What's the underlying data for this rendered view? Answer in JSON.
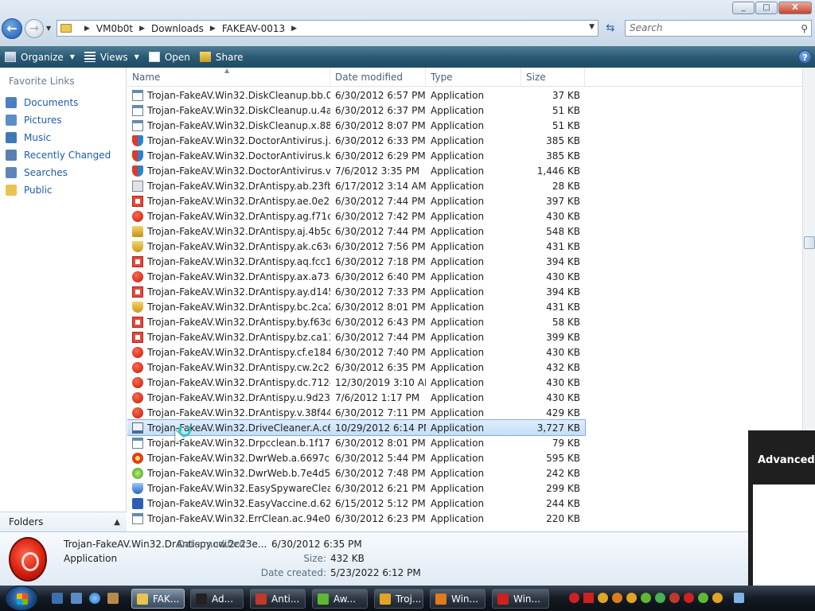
{
  "window": {
    "buttons": [
      "_",
      "□",
      "X"
    ]
  },
  "address": {
    "crumbs": [
      "VM0b0t",
      "Downloads",
      "FAKEAV-0013"
    ],
    "search_placeholder": "Search"
  },
  "toolbar": {
    "organize": "Organize",
    "views": "Views",
    "open": "Open",
    "share": "Share",
    "help": "?"
  },
  "navpane": {
    "header": "Favorite Links",
    "items": [
      {
        "label": "Documents",
        "icon": "documents-icon",
        "color": "#4a7fc0"
      },
      {
        "label": "Pictures",
        "icon": "pictures-icon",
        "color": "#5c8fc5"
      },
      {
        "label": "Music",
        "icon": "music-icon",
        "color": "#3f78b8"
      },
      {
        "label": "Recently Changed",
        "icon": "recently-changed-icon",
        "color": "#5a7fb3"
      },
      {
        "label": "Searches",
        "icon": "searches-icon",
        "color": "#5c86b8"
      },
      {
        "label": "Public",
        "icon": "public-folder-icon",
        "color": "#e6c450"
      }
    ],
    "folders": "Folders"
  },
  "columns": [
    "Name",
    "Date modified",
    "Type",
    "Size"
  ],
  "files": [
    {
      "name": "Trojan-FakeAV.Win32.DiskCleanup.bb.03...",
      "date": "6/30/2012 6:57 PM",
      "type": "Application",
      "size": "37 KB",
      "icon": "app-window"
    },
    {
      "name": "Trojan-FakeAV.Win32.DiskCleanup.u.4aa...",
      "date": "6/30/2012 6:37 PM",
      "type": "Application",
      "size": "51 KB",
      "icon": "app-window"
    },
    {
      "name": "Trojan-FakeAV.Win32.DiskCleanup.x.88c...",
      "date": "6/30/2012 8:07 PM",
      "type": "Application",
      "size": "51 KB",
      "icon": "app-window"
    },
    {
      "name": "Trojan-FakeAV.Win32.DoctorAntivirus.j.2...",
      "date": "6/30/2012 6:33 PM",
      "type": "Application",
      "size": "385 KB",
      "icon": "shield"
    },
    {
      "name": "Trojan-FakeAV.Win32.DoctorAntivirus.k....",
      "date": "6/30/2012 6:29 PM",
      "type": "Application",
      "size": "385 KB",
      "icon": "shield"
    },
    {
      "name": "Trojan-FakeAV.Win32.DoctorAntivirus.v....",
      "date": "7/6/2012 3:35 PM",
      "type": "Application",
      "size": "1,446 KB",
      "icon": "shield"
    },
    {
      "name": "Trojan-FakeAV.Win32.DrAntispy.ab.23fb...",
      "date": "6/17/2012 3:14 AM",
      "type": "Application",
      "size": "28 KB",
      "icon": "app-gray"
    },
    {
      "name": "Trojan-FakeAV.Win32.DrAntispy.ae.0e28...",
      "date": "6/30/2012 7:44 PM",
      "type": "Application",
      "size": "397 KB",
      "icon": "red-doc"
    },
    {
      "name": "Trojan-FakeAV.Win32.DrAntispy.ag.f71c...",
      "date": "6/30/2012 7:42 PM",
      "type": "Application",
      "size": "430 KB",
      "icon": "red-circle"
    },
    {
      "name": "Trojan-FakeAV.Win32.DrAntispy.aj.4b5d3...",
      "date": "6/30/2012 7:44 PM",
      "type": "Application",
      "size": "548 KB",
      "icon": "lock"
    },
    {
      "name": "Trojan-FakeAV.Win32.DrAntispy.ak.c63d...",
      "date": "6/30/2012 7:56 PM",
      "type": "Application",
      "size": "431 KB",
      "icon": "gold-shield"
    },
    {
      "name": "Trojan-FakeAV.Win32.DrAntispy.aq.fcc13...",
      "date": "6/30/2012 7:18 PM",
      "type": "Application",
      "size": "394 KB",
      "icon": "red-doc"
    },
    {
      "name": "Trojan-FakeAV.Win32.DrAntispy.ax.a73aa...",
      "date": "6/30/2012 6:40 PM",
      "type": "Application",
      "size": "430 KB",
      "icon": "red-circle"
    },
    {
      "name": "Trojan-FakeAV.Win32.DrAntispy.ay.d145...",
      "date": "6/30/2012 7:33 PM",
      "type": "Application",
      "size": "394 KB",
      "icon": "red-doc"
    },
    {
      "name": "Trojan-FakeAV.Win32.DrAntispy.bc.2ca2...",
      "date": "6/30/2012 8:01 PM",
      "type": "Application",
      "size": "431 KB",
      "icon": "gold-shield"
    },
    {
      "name": "Trojan-FakeAV.Win32.DrAntispy.by.f63df...",
      "date": "6/30/2012 6:43 PM",
      "type": "Application",
      "size": "58 KB",
      "icon": "red-doc"
    },
    {
      "name": "Trojan-FakeAV.Win32.DrAntispy.bz.ca11...",
      "date": "6/30/2012 7:44 PM",
      "type": "Application",
      "size": "399 KB",
      "icon": "red-doc"
    },
    {
      "name": "Trojan-FakeAV.Win32.DrAntispy.cf.e1842...",
      "date": "6/30/2012 7:40 PM",
      "type": "Application",
      "size": "430 KB",
      "icon": "red-circle"
    },
    {
      "name": "Trojan-FakeAV.Win32.DrAntispy.cw.2c23...",
      "date": "6/30/2012 6:35 PM",
      "type": "Application",
      "size": "432 KB",
      "icon": "red-circle"
    },
    {
      "name": "Trojan-FakeAV.Win32.DrAntispy.dc.712d...",
      "date": "12/30/2019 3:10 AM",
      "type": "Application",
      "size": "430 KB",
      "icon": "red-circle"
    },
    {
      "name": "Trojan-FakeAV.Win32.DrAntispy.u.9d23f...",
      "date": "7/6/2012 1:17 PM",
      "type": "Application",
      "size": "430 KB",
      "icon": "red-circle"
    },
    {
      "name": "Trojan-FakeAV.Win32.DrAntispy.v.38f446...",
      "date": "6/30/2012 7:11 PM",
      "type": "Application",
      "size": "429 KB",
      "icon": "red-circle"
    },
    {
      "name": "Trojan-FakeAV.Win32.DriveCleaner.A.c6c...",
      "date": "10/29/2012 6:14 PM",
      "type": "Application",
      "size": "3,727 KB",
      "icon": "drive",
      "selected": true
    },
    {
      "name": "Trojan-FakeAV.Win32.Drpcclean.b.1f178...",
      "date": "6/30/2012 8:01 PM",
      "type": "Application",
      "size": "79 KB",
      "icon": "app-window"
    },
    {
      "name": "Trojan-FakeAV.Win32.DwrWeb.a.6697cc6...",
      "date": "6/30/2012 5:44 PM",
      "type": "Application",
      "size": "595 KB",
      "icon": "red-cross"
    },
    {
      "name": "Trojan-FakeAV.Win32.DwrWeb.b.7e4d5c...",
      "date": "6/30/2012 7:48 PM",
      "type": "Application",
      "size": "242 KB",
      "icon": "green-plus"
    },
    {
      "name": "Trojan-FakeAV.Win32.EasySpywareClean...",
      "date": "6/30/2012 6:21 PM",
      "type": "Application",
      "size": "299 KB",
      "icon": "blue-shield"
    },
    {
      "name": "Trojan-FakeAV.Win32.EasyVaccine.d.62a...",
      "date": "6/15/2012 5:12 PM",
      "type": "Application",
      "size": "244 KB",
      "icon": "blue-t"
    },
    {
      "name": "Trojan-FakeAV.Win32.ErrClean.ac.94e0c6...",
      "date": "6/30/2012 6:23 PM",
      "type": "Application",
      "size": "220 KB",
      "icon": "app-window"
    }
  ],
  "details": {
    "name": "Trojan-FakeAV.Win32.DrAntispy.cw.2c23e...",
    "type": "Application",
    "date_modified_label": "Date modified:",
    "date_modified": "6/30/2012 6:35 PM",
    "size_label": "Size:",
    "size": "432 KB",
    "date_created_label": "Date created:",
    "date_created": "5/23/2022 6:12 PM"
  },
  "background_dialog": {
    "title": "Advanced"
  },
  "taskbar": {
    "tasks": [
      {
        "label": "FAK...",
        "icon": "folder-icon",
        "color": "#e6c450",
        "active": true
      },
      {
        "label": "Ad...",
        "icon": "cmd-icon",
        "color": "#222222"
      },
      {
        "label": "Anti...",
        "icon": "antivirus-icon",
        "color": "#c0392b"
      },
      {
        "label": "Aw...",
        "icon": "green-plus-icon",
        "color": "#5fb832"
      },
      {
        "label": "Troj...",
        "icon": "shield-icon",
        "color": "#e0a526"
      },
      {
        "label": "Win...",
        "icon": "gear-icon",
        "color": "#e07a1f"
      },
      {
        "label": "Win...",
        "icon": "warning-icon",
        "color": "#d02020"
      }
    ]
  }
}
